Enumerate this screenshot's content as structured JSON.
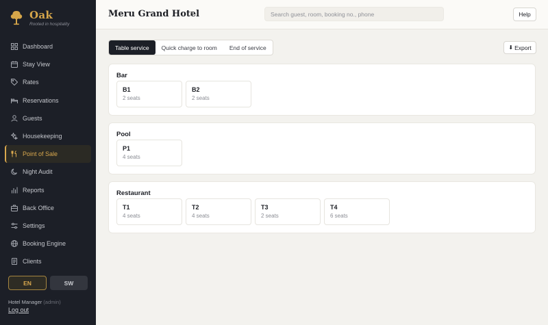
{
  "brand": {
    "name": "Oak",
    "tagline": "Rooted in hospitality"
  },
  "nav": [
    {
      "label": "Dashboard",
      "icon": "grid-icon"
    },
    {
      "label": "Stay View",
      "icon": "calendar-icon"
    },
    {
      "label": "Rates",
      "icon": "tag-icon"
    },
    {
      "label": "Reservations",
      "icon": "bed-icon"
    },
    {
      "label": "Guests",
      "icon": "user-icon"
    },
    {
      "label": "Housekeeping",
      "icon": "sparkle-icon"
    },
    {
      "label": "Point of Sale",
      "icon": "utensils-icon",
      "active": true
    },
    {
      "label": "Night Audit",
      "icon": "moon-icon"
    },
    {
      "label": "Reports",
      "icon": "bar-chart-icon"
    },
    {
      "label": "Back Office",
      "icon": "briefcase-icon"
    },
    {
      "label": "Settings",
      "icon": "gear-icon"
    },
    {
      "label": "Booking Engine",
      "icon": "globe-icon"
    },
    {
      "label": "Clients",
      "icon": "document-icon"
    }
  ],
  "language": {
    "en": "EN",
    "sw": "SW",
    "selected": "EN"
  },
  "user": {
    "role": "Hotel Manager",
    "sub": "(admin)",
    "logout": "Log out"
  },
  "header": {
    "hotel_name": "Meru Grand Hotel",
    "hotel_caret": "▾",
    "search_placeholder": "Search guest, room, booking no., phone",
    "help": "Help"
  },
  "tabs": [
    {
      "label": "Table service",
      "active": true
    },
    {
      "label": "Quick charge to room"
    },
    {
      "label": "End of service"
    }
  ],
  "export": {
    "label": "Export"
  },
  "sections": [
    {
      "title": "Bar",
      "tables": [
        {
          "name": "B1",
          "seats": "2 seats"
        },
        {
          "name": "B2",
          "seats": "2 seats"
        }
      ]
    },
    {
      "title": "Pool",
      "tables": [
        {
          "name": "P1",
          "seats": "4 seats"
        }
      ]
    },
    {
      "title": "Restaurant",
      "tables": [
        {
          "name": "T1",
          "seats": "4 seats"
        },
        {
          "name": "T2",
          "seats": "4 seats"
        },
        {
          "name": "T3",
          "seats": "2 seats"
        },
        {
          "name": "T4",
          "seats": "6 seats"
        }
      ]
    }
  ],
  "colors": {
    "accent": "#d9a84e",
    "sidebar": "#1c1f27",
    "background": "#f3f2ee"
  }
}
